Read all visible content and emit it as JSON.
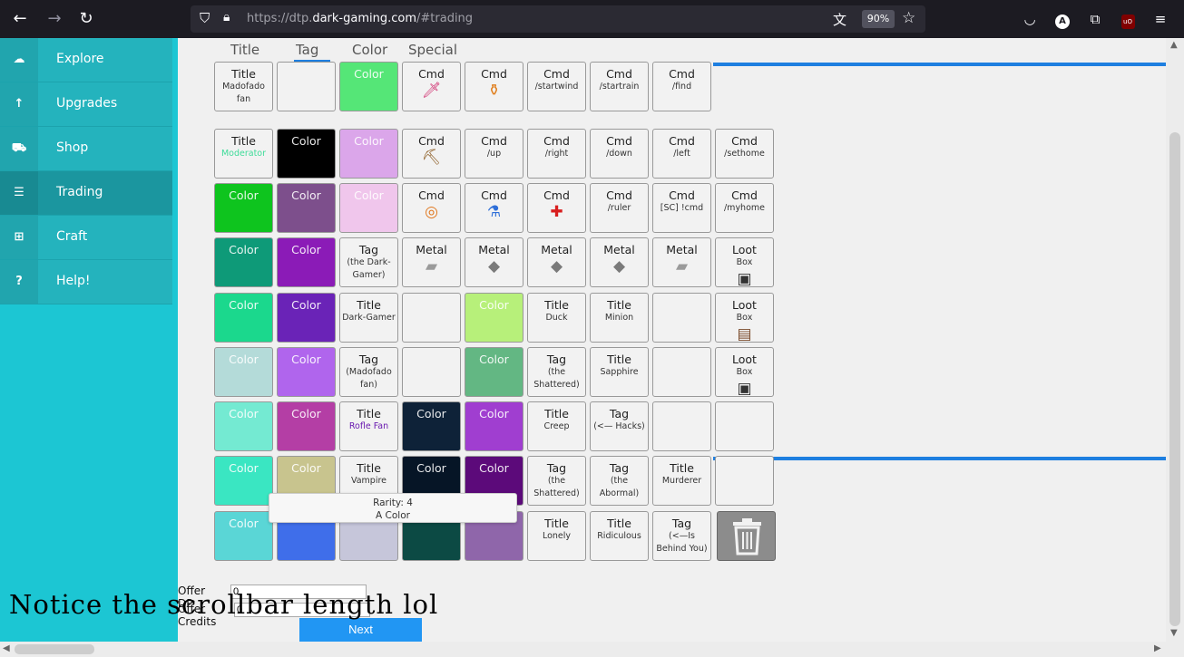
{
  "browser": {
    "url_prefix": "https://dtp.",
    "url_domain": "dark-gaming.com",
    "url_suffix": "/#trading",
    "zoom": "90%"
  },
  "sidebar": {
    "items": [
      {
        "label": "Explore",
        "icon": "cloud-icon"
      },
      {
        "label": "Upgrades",
        "icon": "arrow-up-icon"
      },
      {
        "label": "Shop",
        "icon": "cart-icon"
      },
      {
        "label": "Trading",
        "icon": "list-icon"
      },
      {
        "label": "Craft",
        "icon": "plus-box-icon"
      },
      {
        "label": "Help!",
        "icon": "question-icon"
      }
    ]
  },
  "headers": [
    "Title",
    "Tag",
    "Color",
    "Special"
  ],
  "rows": [
    [
      {
        "t1": "Title",
        "t2": "Madofado fan"
      },
      {
        "t1": "",
        "t2": ""
      },
      {
        "t1": "Color",
        "bg": "#55e677",
        "kind": "color"
      },
      {
        "t1": "Cmd",
        "icon": "🗡",
        "icon_color": "#d03070"
      },
      {
        "t1": "Cmd",
        "icon": "⚱",
        "icon_color": "#e08020"
      },
      {
        "t1": "Cmd",
        "t2": "/startwind"
      },
      {
        "t1": "Cmd",
        "t2": "/startrain"
      },
      {
        "t1": "Cmd",
        "t2": "/find"
      }
    ],
    [
      {
        "t1": "Title",
        "t2": "Moderator",
        "t2_color": "#3fdc9a"
      },
      {
        "t1": "Color",
        "bg": "#000000",
        "kind": "color"
      },
      {
        "t1": "Color",
        "bg": "#dba6ea",
        "kind": "color"
      },
      {
        "t1": "Cmd",
        "icon": "⛏",
        "icon_color": "#8a5a20"
      },
      {
        "t1": "Cmd",
        "t2": "/up"
      },
      {
        "t1": "Cmd",
        "t2": "/right"
      },
      {
        "t1": "Cmd",
        "t2": "/down"
      },
      {
        "t1": "Cmd",
        "t2": "/left"
      },
      {
        "t1": "Cmd",
        "t2": "/sethome"
      }
    ],
    [
      {
        "t1": "Color",
        "bg": "#0ec41e",
        "kind": "color"
      },
      {
        "t1": "Color",
        "bg": "#7d4f8c",
        "kind": "color"
      },
      {
        "t1": "Color",
        "bg": "#f0c6ec",
        "kind": "color"
      },
      {
        "t1": "Cmd",
        "icon": "◎",
        "icon_color": "#e07820"
      },
      {
        "t1": "Cmd",
        "icon": "⚗",
        "icon_color": "#2f6fd8"
      },
      {
        "t1": "Cmd",
        "icon": "✚",
        "icon_color": "#d81e1e"
      },
      {
        "t1": "Cmd",
        "t2": "/ruler"
      },
      {
        "t1": "Cmd",
        "t2": "[SC] !cmd"
      },
      {
        "t1": "Cmd",
        "t2": "/myhome"
      }
    ],
    [
      {
        "t1": "Color",
        "bg": "#0e9a78",
        "kind": "color"
      },
      {
        "t1": "Color",
        "bg": "#8b1bb7",
        "kind": "color"
      },
      {
        "t1": "Tag",
        "t2": "(the Dark-Gamer)"
      },
      {
        "t1": "Metal",
        "icon": "▰",
        "icon_color": "#9a9a9a"
      },
      {
        "t1": "Metal",
        "icon": "◆",
        "icon_color": "#7a7a7a"
      },
      {
        "t1": "Metal",
        "icon": "◆",
        "icon_color": "#7a7a7a"
      },
      {
        "t1": "Metal",
        "icon": "◆",
        "icon_color": "#7a7a7a"
      },
      {
        "t1": "Metal",
        "icon": "▰",
        "icon_color": "#9a9a9a"
      },
      {
        "t1": "Loot",
        "t2": "Box",
        "icon": "▣",
        "icon_color": "#333333"
      }
    ],
    [
      {
        "t1": "Color",
        "bg": "#1bd88d",
        "kind": "color"
      },
      {
        "t1": "Color",
        "bg": "#6a23b7",
        "kind": "color"
      },
      {
        "t1": "Title",
        "t2": "Dark-Gamer"
      },
      {
        "t1": "",
        "t2": ""
      },
      {
        "t1": "Color",
        "bg": "#b7f07a",
        "kind": "color"
      },
      {
        "t1": "Title",
        "t2": "Duck"
      },
      {
        "t1": "Title",
        "t2": "Minion"
      },
      {
        "t1": "",
        "t2": ""
      },
      {
        "t1": "Loot",
        "t2": "Box",
        "icon": "▤",
        "icon_color": "#7a4a2a"
      }
    ],
    [
      {
        "t1": "Color",
        "bg": "#b4dbd9",
        "kind": "color"
      },
      {
        "t1": "Color",
        "bg": "#b065ed",
        "kind": "color"
      },
      {
        "t1": "Tag",
        "t2": "(Madofado fan)"
      },
      {
        "t1": "",
        "t2": ""
      },
      {
        "t1": "Color",
        "bg": "#63b783",
        "kind": "color"
      },
      {
        "t1": "Tag",
        "t2": "(the Shattered)"
      },
      {
        "t1": "Title",
        "t2": "Sapphire"
      },
      {
        "t1": "",
        "t2": ""
      },
      {
        "t1": "Loot",
        "t2": "Box",
        "icon": "▣",
        "icon_color": "#333333"
      }
    ],
    [
      {
        "t1": "Color",
        "bg": "#74ead2",
        "kind": "color"
      },
      {
        "t1": "Color",
        "bg": "#b43ea5",
        "kind": "color"
      },
      {
        "t1": "Title",
        "t2": "Rofle Fan",
        "t2_color": "#6a1bb0"
      },
      {
        "t1": "Color",
        "bg": "#0e2238",
        "kind": "color"
      },
      {
        "t1": "Color",
        "bg": "#a03ed0",
        "kind": "color"
      },
      {
        "t1": "Title",
        "t2": "Creep"
      },
      {
        "t1": "Tag",
        "t2": "(<— Hacks)"
      },
      {
        "t1": "",
        "t2": ""
      },
      {
        "t1": "",
        "t2": ""
      }
    ],
    [
      {
        "t1": "Color",
        "bg": "#3ae6c2",
        "kind": "color"
      },
      {
        "t1": "Color",
        "bg": "#c8c48e",
        "kind": "color"
      },
      {
        "t1": "Title",
        "t2": "Vampire"
      },
      {
        "t1": "Color",
        "bg": "#061526",
        "kind": "color"
      },
      {
        "t1": "Color",
        "bg": "#5c0a7a",
        "kind": "color"
      },
      {
        "t1": "Tag",
        "t2": "(the Shattered)"
      },
      {
        "t1": "Tag",
        "t2": "(the Abormal)"
      },
      {
        "t1": "Title",
        "t2": "Murderer"
      },
      {
        "t1": "",
        "t2": ""
      }
    ],
    [
      {
        "t1": "Color",
        "bg": "#5ad6d6",
        "kind": "color"
      },
      {
        "t1": "",
        "bg": "#3f6eea",
        "kind": "color"
      },
      {
        "t1": "",
        "bg": "#c6c6da",
        "kind": "color"
      },
      {
        "t1": "",
        "bg": "#0c4a44",
        "kind": "color"
      },
      {
        "t1": "",
        "bg": "#8f66aa",
        "kind": "color"
      },
      {
        "t1": "Title",
        "t2": "Lonely"
      },
      {
        "t1": "Title",
        "t2": "Ridiculous"
      },
      {
        "t1": "Tag",
        "t2": "(<—Is Behind You)"
      }
    ]
  ],
  "tooltip": {
    "line1": "Rarity: 4",
    "line2": "A Color"
  },
  "offer": {
    "dp_label": "Offer DP",
    "dp_value": "0",
    "credits_label": "Offer Credits",
    "credits_value": "0"
  },
  "next_label": "Next",
  "caption": "Notice the scrollbar length lol"
}
